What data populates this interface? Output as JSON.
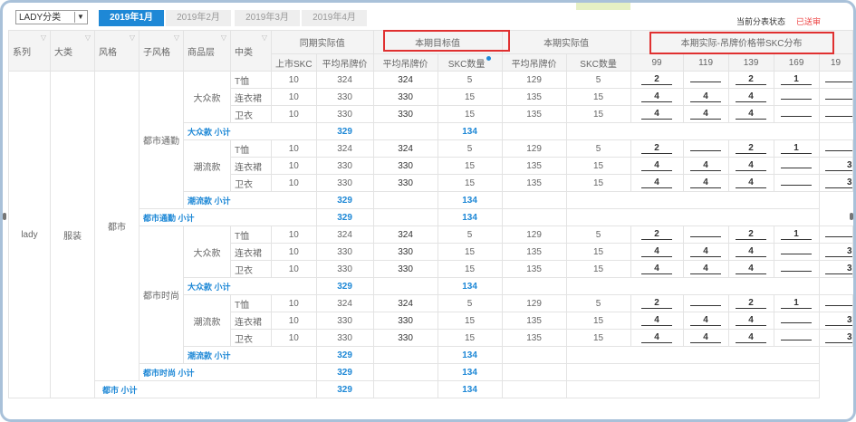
{
  "toolbar": {
    "category_select": "LADY分类",
    "months": [
      "2019年1月",
      "2019年2月",
      "2019年3月",
      "2019年4月"
    ],
    "status_label": "当前分表状态",
    "status_value": "已送审"
  },
  "headers": {
    "dims": [
      "系列",
      "大类",
      "风格",
      "子风格",
      "商品层",
      "中类"
    ],
    "group_same_period": "同期实际值",
    "group_target": "本期目标值",
    "group_actual": "本期实际值",
    "group_distribution": "本期实际-吊牌价格带SKC分布",
    "sub_same_period": [
      "上市SKC",
      "平均吊牌价"
    ],
    "sub_target": [
      "平均吊牌价",
      "SKC数量"
    ],
    "sub_actual": [
      "平均吊牌价",
      "SKC数量"
    ],
    "price_bands": [
      "99",
      "119",
      "139",
      "169",
      "19"
    ]
  },
  "labels": {
    "series": "lady",
    "category": "服装",
    "style": "都市",
    "substyle_1": "都市通勤",
    "substyle_2": "都市时尚",
    "tier_mass": "大众款",
    "tier_trend": "潮流款",
    "mass_subtotal": "大众款 小计",
    "trend_subtotal": "潮流款 小计",
    "substyle_1_subtotal": "都市通勤 小计",
    "substyle_2_subtotal": "都市时尚 小计",
    "style_subtotal": "都市 小计"
  },
  "rows": [
    {
      "type": "data",
      "c": "T恤",
      "sp_skc": "10",
      "sp_price": "324",
      "t_price": "324",
      "t_skc": "5",
      "a_price": "129",
      "a_skc": "5",
      "d": [
        "2",
        "",
        "2",
        "1",
        ""
      ]
    },
    {
      "type": "data",
      "c": "连衣裙",
      "sp_skc": "10",
      "sp_price": "330",
      "t_price": "330",
      "t_skc": "15",
      "a_price": "135",
      "a_skc": "15",
      "d": [
        "4",
        "4",
        "4",
        "",
        ""
      ]
    },
    {
      "type": "data",
      "c": "卫衣",
      "sp_skc": "10",
      "sp_price": "330",
      "t_price": "330",
      "t_skc": "15",
      "a_price": "135",
      "a_skc": "15",
      "d": [
        "4",
        "4",
        "4",
        "",
        ""
      ]
    },
    {
      "type": "sub",
      "label": "mass_subtotal",
      "t_price": "329",
      "a_price": "134"
    },
    {
      "type": "data",
      "c": "T恤",
      "sp_skc": "10",
      "sp_price": "324",
      "t_price": "324",
      "t_skc": "5",
      "a_price": "129",
      "a_skc": "5",
      "d": [
        "2",
        "",
        "2",
        "1",
        ""
      ]
    },
    {
      "type": "data",
      "c": "连衣裙",
      "sp_skc": "10",
      "sp_price": "330",
      "t_price": "330",
      "t_skc": "15",
      "a_price": "135",
      "a_skc": "15",
      "d": [
        "4",
        "4",
        "4",
        "",
        "3"
      ]
    },
    {
      "type": "data",
      "c": "卫衣",
      "sp_skc": "10",
      "sp_price": "330",
      "t_price": "330",
      "t_skc": "15",
      "a_price": "135",
      "a_skc": "15",
      "d": [
        "4",
        "4",
        "4",
        "",
        "3"
      ]
    },
    {
      "type": "sub",
      "label": "trend_subtotal",
      "t_price": "329",
      "a_price": "134"
    },
    {
      "type": "sub2",
      "label": "substyle_1_subtotal",
      "t_price": "329",
      "a_price": "134"
    },
    {
      "type": "data",
      "c": "T恤",
      "sp_skc": "10",
      "sp_price": "324",
      "t_price": "324",
      "t_skc": "5",
      "a_price": "129",
      "a_skc": "5",
      "d": [
        "2",
        "",
        "2",
        "1",
        ""
      ]
    },
    {
      "type": "data",
      "c": "连衣裙",
      "sp_skc": "10",
      "sp_price": "330",
      "t_price": "330",
      "t_skc": "15",
      "a_price": "135",
      "a_skc": "15",
      "d": [
        "4",
        "4",
        "4",
        "",
        "3"
      ]
    },
    {
      "type": "data",
      "c": "卫衣",
      "sp_skc": "10",
      "sp_price": "330",
      "t_price": "330",
      "t_skc": "15",
      "a_price": "135",
      "a_skc": "15",
      "d": [
        "4",
        "4",
        "4",
        "",
        "3"
      ]
    },
    {
      "type": "sub",
      "label": "mass_subtotal",
      "t_price": "329",
      "a_price": "134"
    },
    {
      "type": "data",
      "c": "T恤",
      "sp_skc": "10",
      "sp_price": "324",
      "t_price": "324",
      "t_skc": "5",
      "a_price": "129",
      "a_skc": "5",
      "d": [
        "2",
        "",
        "2",
        "1",
        ""
      ]
    },
    {
      "type": "data",
      "c": "连衣裙",
      "sp_skc": "10",
      "sp_price": "330",
      "t_price": "330",
      "t_skc": "15",
      "a_price": "135",
      "a_skc": "15",
      "d": [
        "4",
        "4",
        "4",
        "",
        "3"
      ]
    },
    {
      "type": "data",
      "c": "卫衣",
      "sp_skc": "10",
      "sp_price": "330",
      "t_price": "330",
      "t_skc": "15",
      "a_price": "135",
      "a_skc": "15",
      "d": [
        "4",
        "4",
        "4",
        "",
        "3"
      ]
    },
    {
      "type": "sub",
      "label": "trend_subtotal",
      "t_price": "329",
      "a_price": "134"
    },
    {
      "type": "sub2",
      "label": "substyle_2_subtotal",
      "t_price": "329",
      "a_price": "134"
    },
    {
      "type": "sub3",
      "label": "style_subtotal",
      "t_price": "329",
      "a_price": "134"
    }
  ]
}
